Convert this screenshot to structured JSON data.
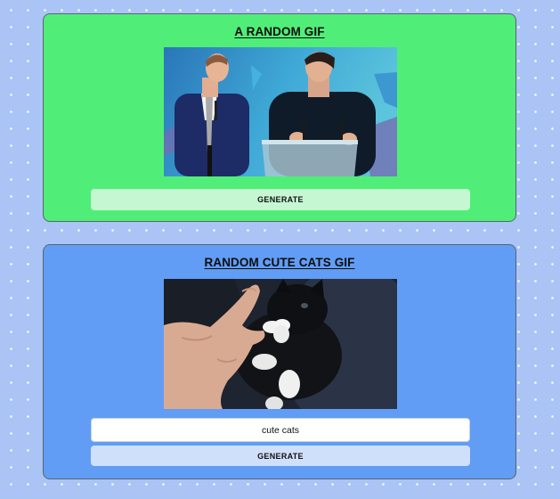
{
  "random_gif": {
    "title": "A RANDOM GIF",
    "gif_alt": "animated gif of two men on a stage",
    "generate_label": "GENERATE"
  },
  "tag_gif": {
    "title": "RANDOM CUTE CATS GIF",
    "gif_alt": "animated gif of a hand petting a black and white kitten",
    "tag_value": "cute cats",
    "generate_label": "GENERATE"
  },
  "colors": {
    "page_background": "#a9c4f5",
    "random_card": "#50ee78",
    "random_button": "#c5f8d2",
    "cats_card": "#619df4",
    "cats_button": "#cfe0fb"
  }
}
